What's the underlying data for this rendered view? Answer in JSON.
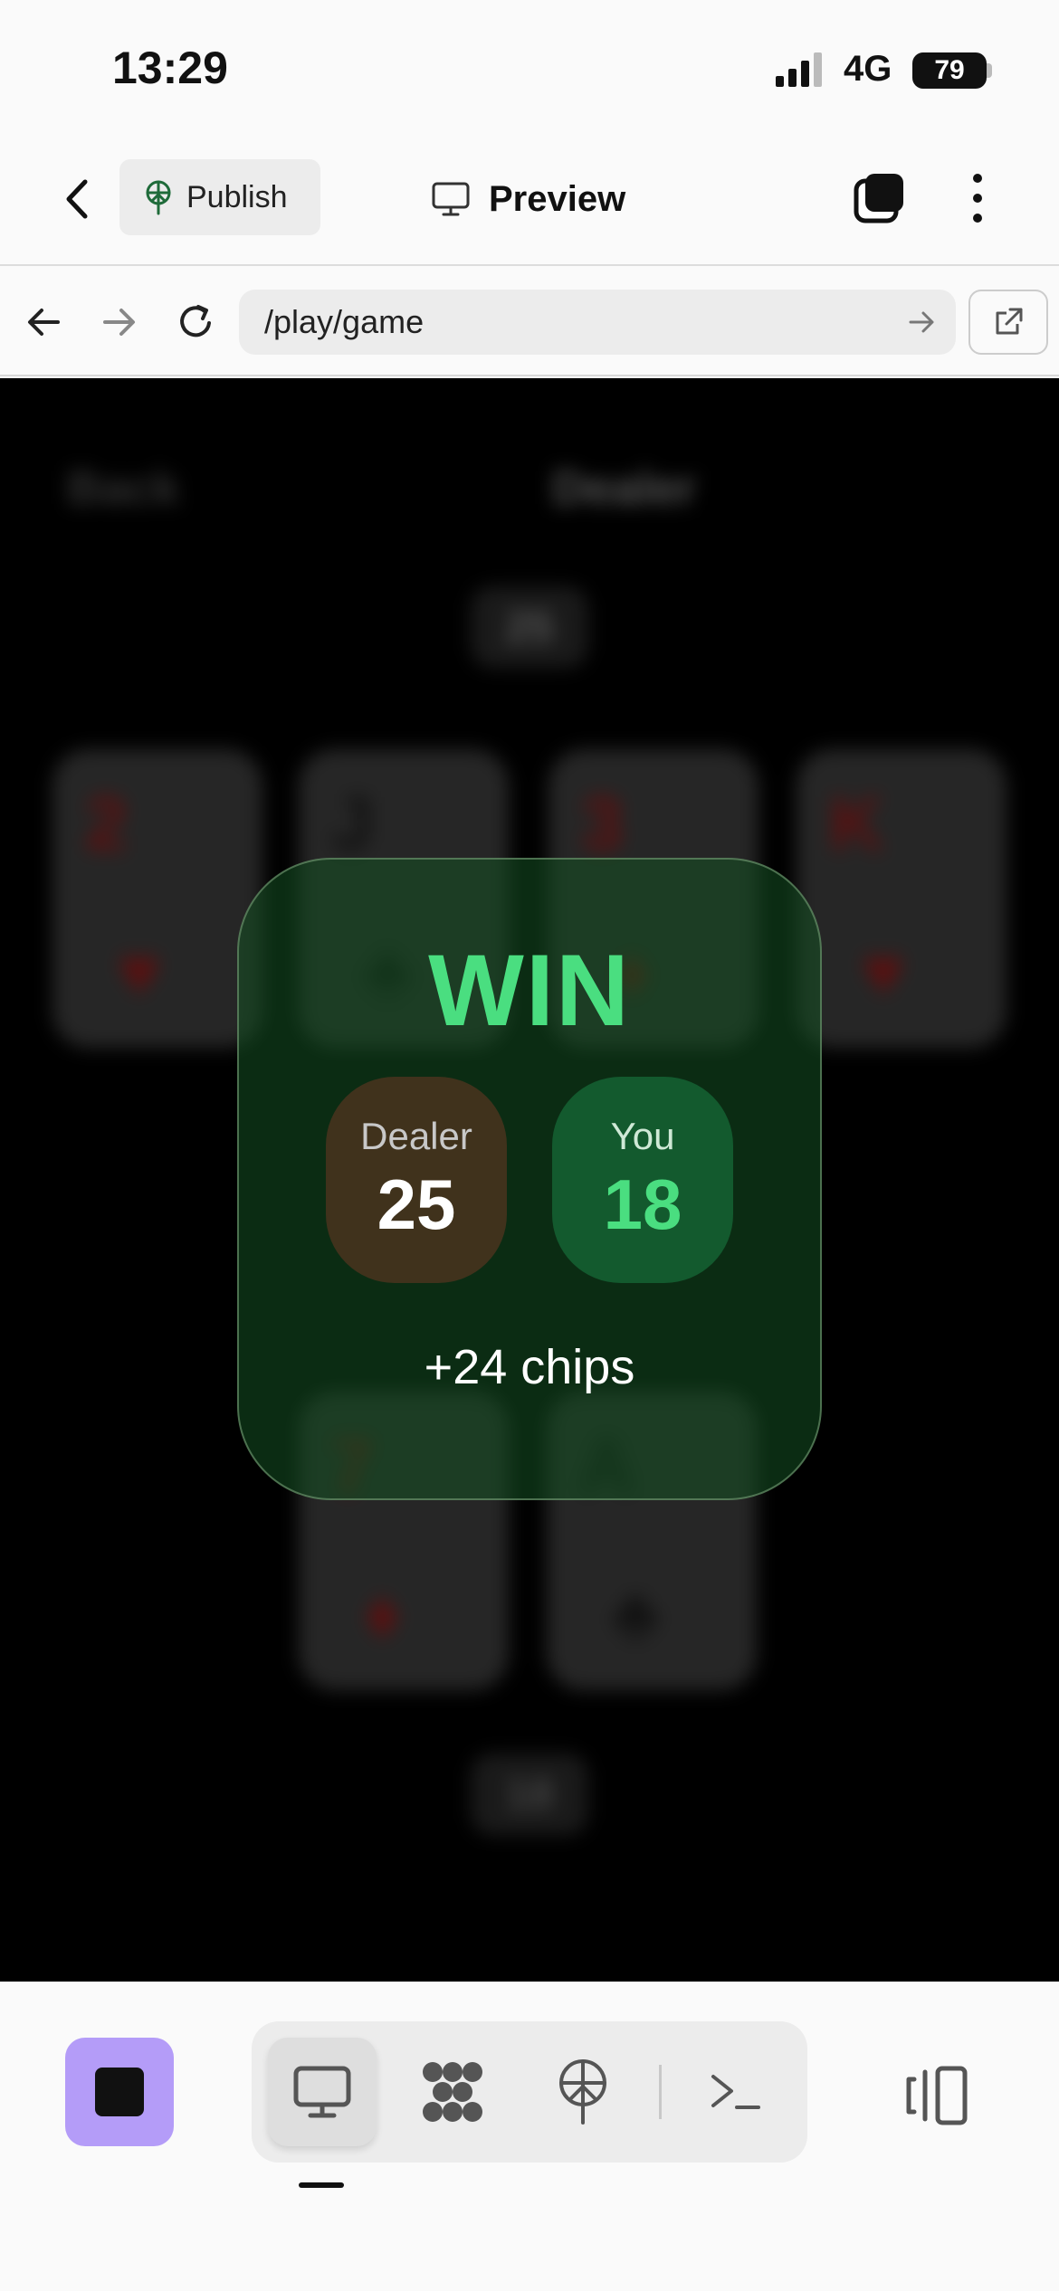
{
  "status_bar": {
    "time": "13:29",
    "network": "4G",
    "battery": "79"
  },
  "app_bar": {
    "publish_label": "Publish",
    "preview_label": "Preview"
  },
  "browser": {
    "url": "/play/game"
  },
  "result": {
    "outcome": "WIN",
    "dealer_label": "Dealer",
    "dealer_score": "25",
    "you_label": "You",
    "you_score": "18",
    "chips": "+24 chips"
  },
  "background_game": {
    "header_left": "Back",
    "header_title": "Dealer",
    "dealer_total": "25",
    "dealer_cards": [
      {
        "rank": "2",
        "suit": "♥"
      },
      {
        "rank": "J",
        "suit": "♣"
      },
      {
        "rank": "3",
        "suit": "♦"
      },
      {
        "rank": "K",
        "suit": "♥"
      }
    ],
    "player_cards": [
      {
        "rank": "7",
        "suit": "♦"
      },
      {
        "rank": "A",
        "suit": "♣"
      }
    ],
    "player_total": "18"
  },
  "colors": {
    "win_green": "#4ade80",
    "stop_purple": "#b49cf8"
  }
}
